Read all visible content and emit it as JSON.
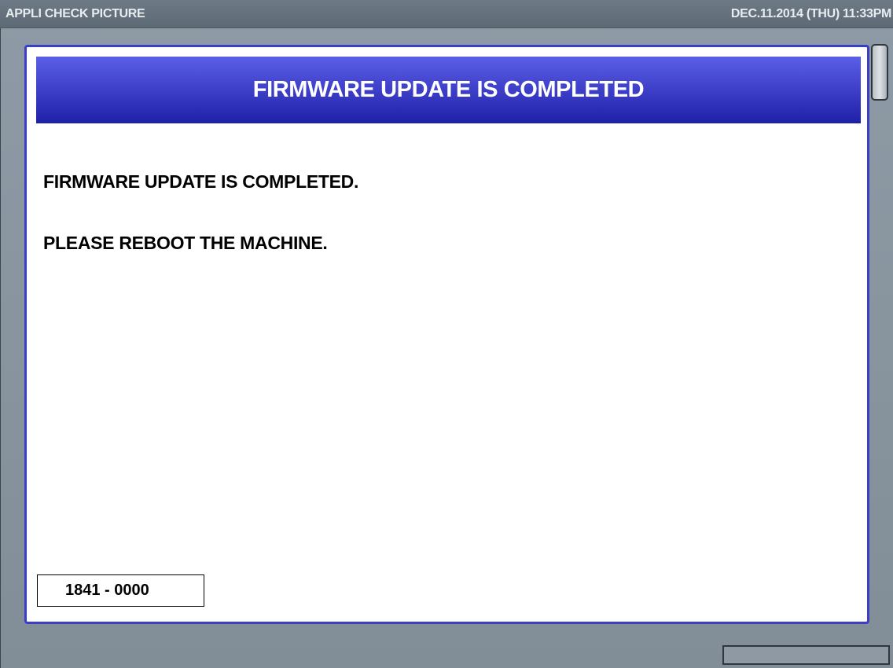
{
  "topbar": {
    "app_title": "APPLI CHECK PICTURE",
    "datetime": "DEC.11.2014 (THU)  11:33PM"
  },
  "dialog": {
    "title": "FIRMWARE UPDATE IS COMPLETED",
    "message_line1": "FIRMWARE UPDATE IS COMPLETED.",
    "message_line2": "PLEASE REBOOT THE MACHINE.",
    "code": "1841 - 0000"
  },
  "colors": {
    "accent": "#3a3fc6",
    "topbar": "#66737f",
    "background": "#8e9aa5"
  }
}
